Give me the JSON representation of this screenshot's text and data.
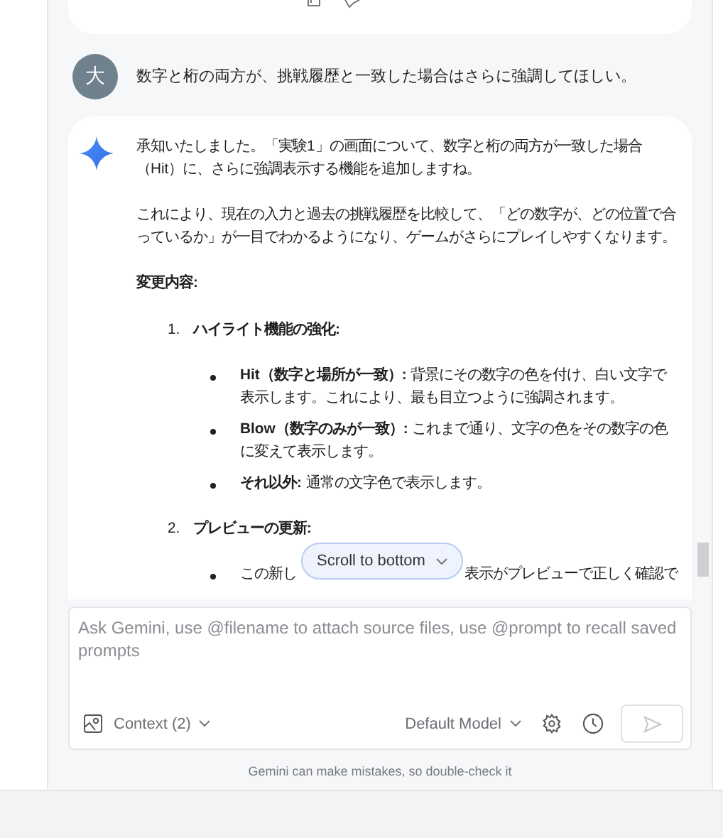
{
  "user_message": {
    "avatar": "大",
    "text": "数字と桁の両方が、挑戦履歴と一致した場合はさらに強調してほしい。"
  },
  "response": {
    "paragraphs": [
      "承知いたしました。「実験1」の画面について、数字と桁の両方が一致した場合（Hit）に、さらに強調表示する機能を追加しますね。",
      "これにより、現在の入力と過去の挑戦履歴を比較して、「どの数字が、どの位置で合っているか」が一目でわかるようになり、ゲームがさらにプレイしやすくなります。"
    ],
    "heading": "変更内容:",
    "steps": [
      {
        "number": "1.",
        "title": "ハイライト機能の強化:",
        "bullets": [
          {
            "parts": [
              "**Hit（数字と場所が一致）:** 背景にその数字の色を付け、白い文字で表示します。これにより、最も目立つように強調されます。"
            ]
          },
          {
            "parts": [
              "**Blow（数字のみが一致）:** これまで通り、文字の色をその数字の色に変えて表示します。"
            ]
          },
          {
            "parts": [
              "**それ以外:** 通常の文字色で表示します。"
            ]
          }
        ]
      },
      {
        "number": "2.",
        "title": "プレビューの更新:",
        "bullets": [
          {
            "parts": [
              "この新し",
              "表示がプレビューで正しく確認で"
            ]
          }
        ]
      }
    ]
  },
  "scroll_button": {
    "label": "Scroll to bottom"
  },
  "input": {
    "placeholder": "Ask Gemini, use @filename to attach source files, use @prompt to recall saved prompts",
    "context": "Context (2)",
    "model": "Default Model"
  },
  "disclaimer": "Gemini can make mistakes, so double-check it"
}
